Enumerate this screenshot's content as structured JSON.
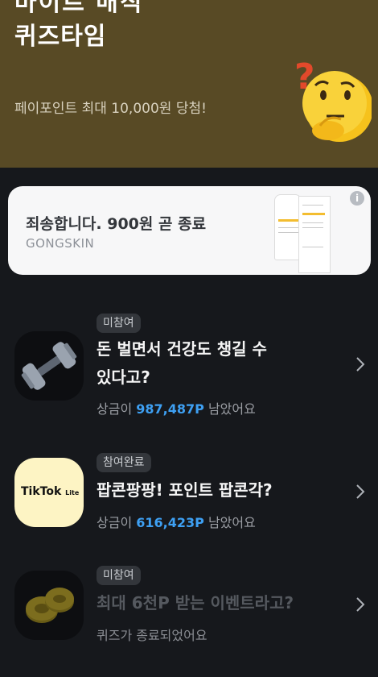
{
  "hero": {
    "cut_title": "마이트 매직",
    "title": "퀴즈타임",
    "subtitle": "페이포인트 최대 10,000원 당첨!",
    "bg_color": "#584a25"
  },
  "ad": {
    "title": "죄송합니다. 900원 곧 종료",
    "brand": "GONGSKIN",
    "info_icon": "i"
  },
  "quizzes": [
    {
      "status": "미참여",
      "title_line1": "돈 벌면서 건강도 챙길 수",
      "title_line2": "있다고?",
      "prize_prefix": "상금이 ",
      "prize_amount": "987,487P",
      "prize_suffix": " 남았어요",
      "icon": "dumbbell-icon"
    },
    {
      "status": "참여완료",
      "title": "팝콘팡팡! 포인트 팝콘각?",
      "prize_prefix": "상금이 ",
      "prize_amount": "616,423P",
      "prize_suffix": " 남았어요",
      "logo_text": "TikTok",
      "logo_sub": "Lite",
      "icon": "tiktok-lite-logo"
    },
    {
      "status": "미참여",
      "title": "최대 6천P 받는 이벤트라고?",
      "ended_text": "퀴즈가 종료되었어요",
      "icon": "coins-icon"
    }
  ],
  "colors": {
    "accent": "#3ea0f3",
    "bg": "#16181c",
    "badge": "#33363b"
  }
}
